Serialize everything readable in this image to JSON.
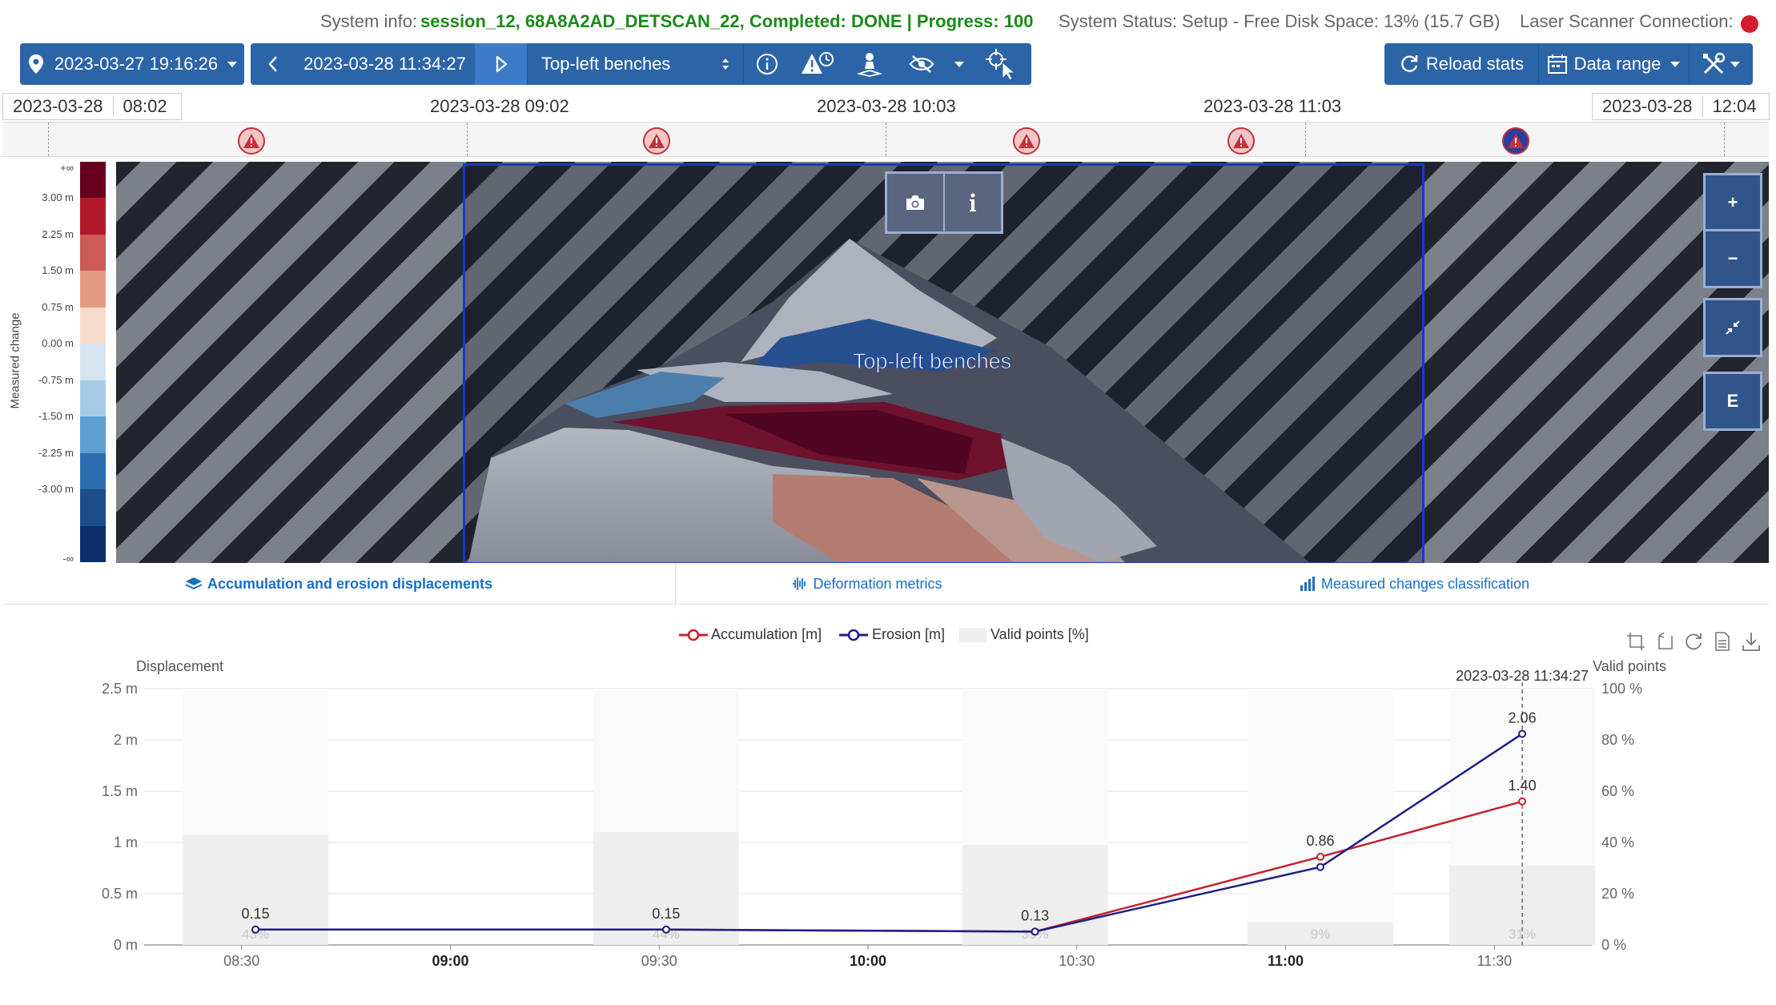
{
  "info_bar": {
    "system_info_label": "System info:",
    "system_info_value": "session_12, 68A8A2AD_DETSCAN_22, Completed: DONE | Progress: 100",
    "system_status": "System Status: Setup - Free Disk Space: 13% (15.7 GB)",
    "connection_label": "Laser Scanner Connection:",
    "connection_status_color": "#d61c2c"
  },
  "toolbar": {
    "start_datetime": "2023-03-27 19:16:26",
    "current_datetime": "2023-03-28 11:34:27",
    "region_select": "Top-left benches",
    "reload_label": "Reload stats",
    "data_range_label": "Data range",
    "accent_color": "#2c64a8"
  },
  "timeline": {
    "left_date": "2023-03-28",
    "left_time": "08:02",
    "right_date": "2023-03-28",
    "right_time": "12:04",
    "tick_labels": [
      "2023-03-28 09:02",
      "2023-03-28 10:03",
      "2023-03-28 11:03"
    ],
    "alert_icon": "warning-triangle-icon"
  },
  "color_legend": {
    "axis_title": "Measured change",
    "top_label": "+∞",
    "bottom_label": "-∞",
    "labels": [
      "3.00 m",
      "2.25 m",
      "1.50 m",
      "0.75 m",
      "0.00 m",
      "-0.75 m",
      "-1.50 m",
      "-2.25 m",
      "-3.00 m"
    ],
    "colors": [
      "#67001f",
      "#b2182b",
      "#cc5a55",
      "#e59a83",
      "#f7dccd",
      "#d7e5f0",
      "#a7cbe5",
      "#5c9fd0",
      "#2b6eb0",
      "#1e4d8c",
      "#0b2e6b"
    ]
  },
  "map": {
    "region_label": "Top-left benches",
    "zoom_in": "+",
    "zoom_out": "−",
    "extent_button": "E",
    "roi_color": "#1e37c8"
  },
  "tabs": [
    {
      "label": "Accumulation and erosion displacements",
      "icon": "layers-icon"
    },
    {
      "label": "Deformation metrics",
      "icon": "waveform-icon"
    },
    {
      "label": "Measured changes classification",
      "icon": "bar-chart-icon"
    }
  ],
  "chart_data": {
    "type": "line",
    "legend": [
      "Accumulation [m]",
      "Erosion [m]",
      "Valid points [%]"
    ],
    "y_left_label": "Displacement",
    "y_right_label": "Valid points",
    "y_left_ticks": [
      "0 m",
      "0.5 m",
      "1 m",
      "1.5 m",
      "2 m",
      "2.5 m"
    ],
    "y_right_ticks": [
      "0 %",
      "20 %",
      "40 %",
      "60 %",
      "80 %",
      "100 %"
    ],
    "x_ticks": [
      "08:30",
      "09:00",
      "09:30",
      "10:00",
      "10:30",
      "11:00",
      "11:30"
    ],
    "x_ticks_bold": [
      false,
      true,
      false,
      true,
      false,
      true,
      false
    ],
    "ylim": [
      0,
      2.5
    ],
    "ylim_right": [
      0,
      100
    ],
    "x_times": [
      "08:32",
      "09:31",
      "10:24",
      "11:05",
      "11:34"
    ],
    "series": [
      {
        "name": "Accumulation [m]",
        "color": "#c4222f",
        "values": [
          0.15,
          0.15,
          0.13,
          0.86,
          1.4
        ]
      },
      {
        "name": "Erosion [m]",
        "color": "#1e1f86",
        "values": [
          0.15,
          0.15,
          0.13,
          0.76,
          2.06
        ]
      }
    ],
    "data_labels": [
      "0.15",
      "0.15",
      "0.13",
      "0.86",
      "1.40",
      "2.06"
    ],
    "valid_points_percent": [
      43,
      44,
      39,
      9,
      31
    ],
    "valid_points_labels": [
      "43%",
      "44%",
      "39%",
      "9%",
      "31%"
    ],
    "cursor_label": "2023-03-28 11:34:27"
  }
}
